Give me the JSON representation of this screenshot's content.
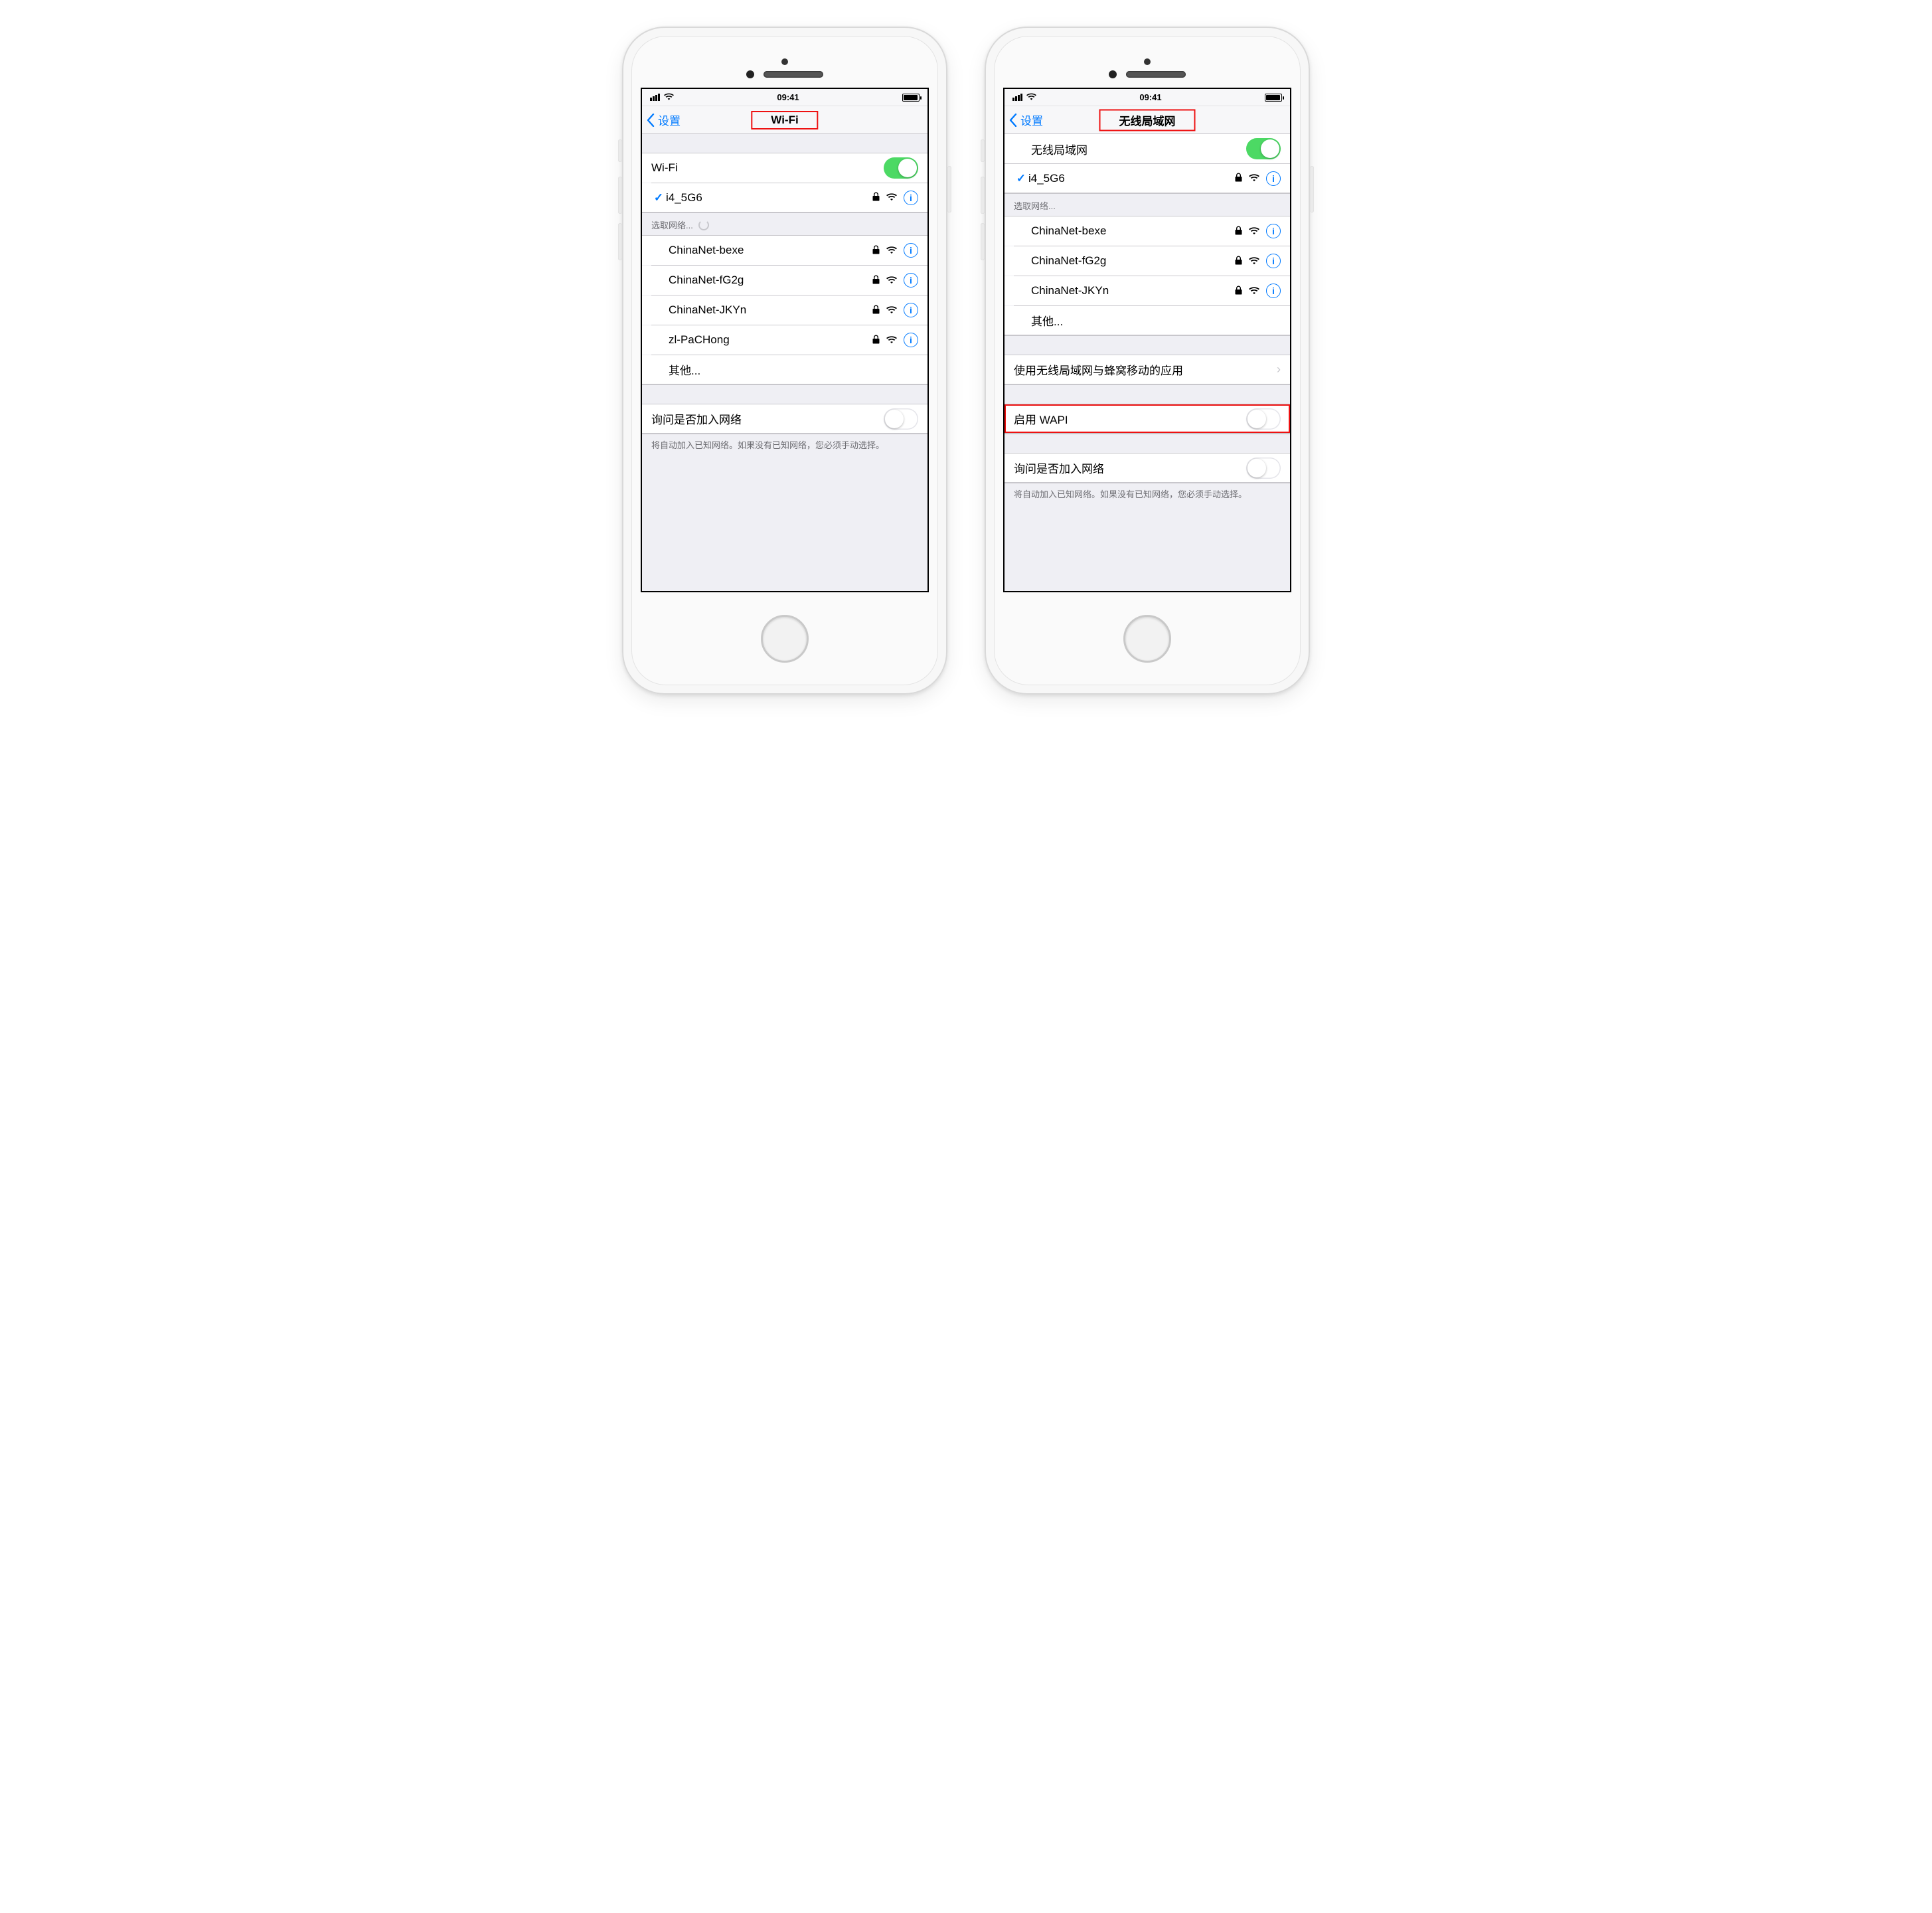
{
  "phone_left": {
    "status": {
      "time": "09:41"
    },
    "nav": {
      "back_label": "设置",
      "title": "Wi-Fi"
    },
    "wifi_toggle": {
      "label": "Wi-Fi",
      "on": true
    },
    "connected": {
      "name": "i4_5G6",
      "locked": true
    },
    "choose_header": "选取网络...",
    "networks": [
      {
        "name": "ChinaNet-bexe",
        "locked": true
      },
      {
        "name": "ChinaNet-fG2g",
        "locked": true
      },
      {
        "name": "ChinaNet-JKYn",
        "locked": true
      },
      {
        "name": "zl-PaCHong",
        "locked": true
      }
    ],
    "other_label": "其他...",
    "ask_join": {
      "label": "询问是否加入网络",
      "on": false
    },
    "ask_note": "将自动加入已知网络。如果没有已知网络，您必须手动选择。"
  },
  "phone_right": {
    "status": {
      "time": "09:41"
    },
    "nav": {
      "back_label": "设置",
      "title": "无线局域网"
    },
    "wifi_toggle": {
      "label": "无线局域网",
      "on": true
    },
    "connected": {
      "name": "i4_5G6",
      "locked": true
    },
    "choose_header": "选取网络...",
    "networks": [
      {
        "name": "ChinaNet-bexe",
        "locked": true
      },
      {
        "name": "ChinaNet-fG2g",
        "locked": true
      },
      {
        "name": "ChinaNet-JKYn",
        "locked": true
      }
    ],
    "other_label": "其他...",
    "apps_row": "使用无线局域网与蜂窝移动的应用",
    "wapi": {
      "label": "启用 WAPI",
      "on": false
    },
    "ask_join": {
      "label": "询问是否加入网络",
      "on": false
    },
    "ask_note": "将自动加入已知网络。如果没有已知网络，您必须手动选择。"
  }
}
